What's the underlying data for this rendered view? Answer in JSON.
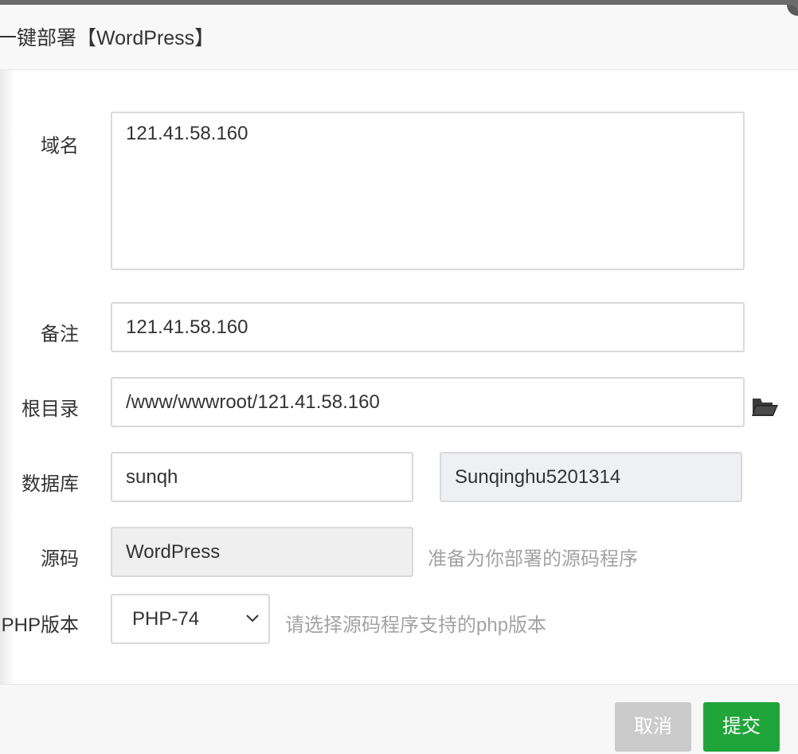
{
  "dialog": {
    "title": "一键部署【WordPress】"
  },
  "form": {
    "domain": {
      "label": "域名",
      "value": "121.41.58.160"
    },
    "remark": {
      "label": "备注",
      "value": "121.41.58.160"
    },
    "root_dir": {
      "label": "根目录",
      "value": "/www/wwwroot/121.41.58.160",
      "icon": "folder-open-icon"
    },
    "database": {
      "label": "数据库",
      "user": "sunqh",
      "password": "Sunqinghu5201314"
    },
    "source": {
      "label": "源码",
      "value": "WordPress",
      "hint": "准备为你部署的源码程序"
    },
    "php_version": {
      "label": "PHP版本",
      "selected": "PHP-74",
      "hint": "请选择源码程序支持的php版本"
    }
  },
  "footer": {
    "cancel_label": "取消",
    "submit_label": "提交"
  },
  "colors": {
    "submit_green": "#20a53a",
    "cancel_gray": "#cbcbcb",
    "hint_gray": "#a3a3a3"
  }
}
